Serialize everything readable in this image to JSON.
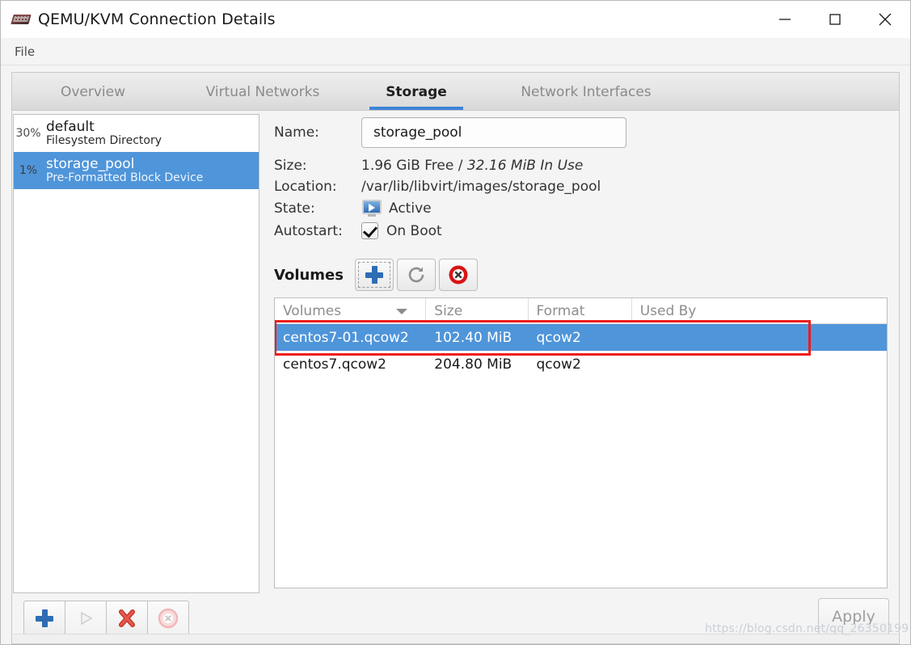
{
  "window": {
    "title": "QEMU/KVM Connection Details",
    "icon": "kvm-app-icon",
    "controls": {
      "minimize": "minimize-icon",
      "maximize": "maximize-icon",
      "close": "close-icon"
    }
  },
  "menubar": {
    "items": [
      {
        "label": "File"
      }
    ]
  },
  "tabs": [
    {
      "label": "Overview",
      "active": false
    },
    {
      "label": "Virtual Networks",
      "active": false
    },
    {
      "label": "Storage",
      "active": true
    },
    {
      "label": "Network Interfaces",
      "active": false
    }
  ],
  "pool_list": [
    {
      "percent": "30%",
      "name": "default",
      "type": "Filesystem Directory",
      "selected": false
    },
    {
      "percent": "1%",
      "name": "storage_pool",
      "type": "Pre-Formatted Block Device",
      "selected": true
    }
  ],
  "details": {
    "name_label": "Name:",
    "name_value": "storage_pool",
    "size_label": "Size:",
    "size_free": "1.96 GiB Free",
    "size_separator": "/",
    "size_inuse": "32.16 MiB In Use",
    "location_label": "Location:",
    "location_value": "/var/lib/libvirt/images/storage_pool",
    "state_label": "State:",
    "state_value": "Active",
    "state_icon": "active-monitor-icon",
    "autostart_label": "Autostart:",
    "autostart_value": "On Boot",
    "autostart_checked": true
  },
  "volumes_section": {
    "title": "Volumes",
    "buttons": [
      {
        "name": "add-volume-button",
        "icon": "plus-icon",
        "focused": true
      },
      {
        "name": "refresh-volumes-button",
        "icon": "refresh-icon",
        "focused": false
      },
      {
        "name": "delete-volume-button",
        "icon": "delete-circle-icon",
        "focused": false
      }
    ],
    "columns": [
      "Volumes",
      "Size",
      "Format",
      "Used By"
    ],
    "sort_column": "Volumes",
    "rows": [
      {
        "volume": "centos7-01.qcow2",
        "size": "102.40 MiB",
        "format": "qcow2",
        "used_by": "",
        "selected": true,
        "annotated": true
      },
      {
        "volume": "centos7.qcow2",
        "size": "204.80 MiB",
        "format": "qcow2",
        "used_by": "",
        "selected": false,
        "annotated": false
      }
    ]
  },
  "bottom_toolbar": {
    "buttons": [
      {
        "name": "add-pool-button",
        "icon": "plus-icon",
        "disabled": false
      },
      {
        "name": "start-pool-button",
        "icon": "play-icon",
        "disabled": true
      },
      {
        "name": "delete-pool-button",
        "icon": "red-x-icon",
        "disabled": false
      },
      {
        "name": "stop-pool-button",
        "icon": "stop-circle-icon",
        "disabled": true
      }
    ],
    "apply_label": "Apply",
    "apply_disabled": true
  },
  "watermark": {
    "text": "https://blog.csdn.net/qq_26350199"
  },
  "colors": {
    "selection_blue": "#4f95da",
    "tab_underline": "#3d84d8",
    "annotation_red": "#ee1c1c",
    "window_bg": "#f4f4f4"
  }
}
